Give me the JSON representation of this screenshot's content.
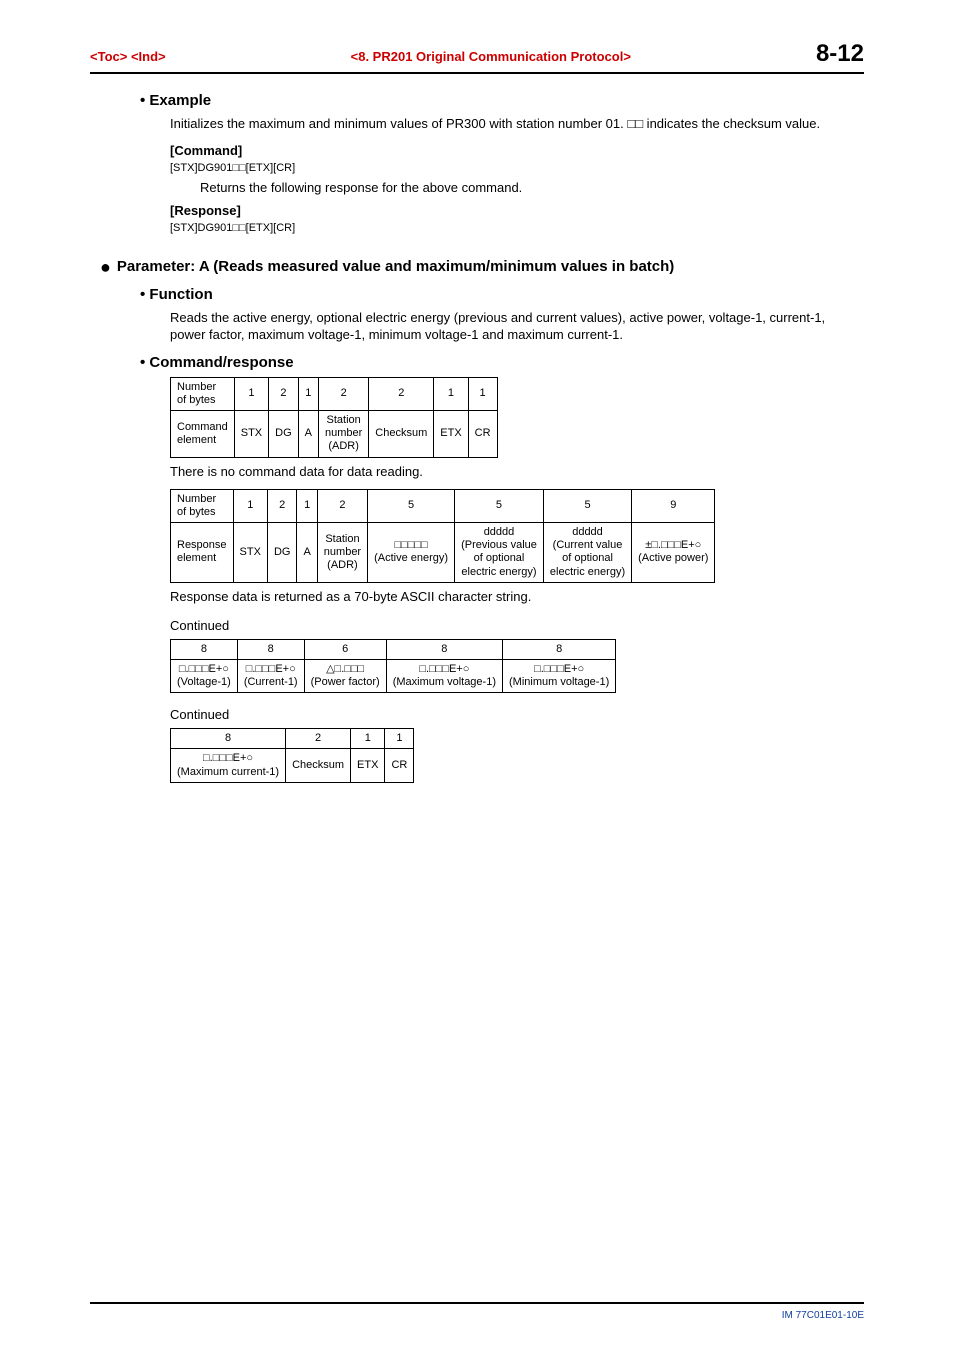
{
  "header": {
    "left": "<Toc> <Ind>",
    "center": "<8.  PR201 Original Communication Protocol>",
    "page": "8-12"
  },
  "example": {
    "title": "Example",
    "intro": "Initializes the maximum and minimum values of PR300 with station number 01. □□ indicates the checksum value.",
    "command_label": "[Command]",
    "command_code": "[STX]DG901□□[ETX][CR]",
    "response_note": "Returns the following response for the above command.",
    "response_label": "[Response]",
    "response_code": "[STX]DG901□□[ETX][CR]"
  },
  "paramA": {
    "title": "Parameter: A (Reads measured value and maximum/minimum values in batch)",
    "function_title": "Function",
    "function_text": "Reads the active energy, optional electric energy (previous and current values), active power, voltage-1, current-1, power factor, maximum voltage-1, minimum voltage-1 and maximum current-1.",
    "cr_title": "Command/response",
    "cmd_table": {
      "row1": [
        "Number\nof bytes",
        "1",
        "2",
        "1",
        "2",
        "2",
        "1",
        "1"
      ],
      "row2": [
        "Command\nelement",
        "STX",
        "DG",
        "A",
        "Station\nnumber\n(ADR)",
        "Checksum",
        "ETX",
        "CR"
      ]
    },
    "no_cmd_note": "There is no command data for data reading.",
    "resp_table": {
      "row1": [
        "Number\nof bytes",
        "1",
        "2",
        "1",
        "2",
        "5",
        "5",
        "5",
        "9"
      ],
      "row2": [
        "Response\nelement",
        "STX",
        "DG",
        "A",
        "Station\nnumber\n(ADR)",
        "□□□□□\n(Active energy)",
        "ddddd\n(Previous value\nof optional\nelectric energy)",
        "ddddd\n(Current value\nof optional\nelectric energy)",
        "±□.□□□E+○\n(Active power)"
      ]
    },
    "resp_note": "Response data is returned as a 70-byte ASCII character string.",
    "continued": "Continued",
    "cont1": {
      "row1": [
        "8",
        "8",
        "6",
        "8",
        "8"
      ],
      "row2": [
        "□.□□□E+○\n(Voltage-1)",
        "□.□□□E+○\n(Current-1)",
        "△□.□□□\n(Power factor)",
        "□.□□□E+○\n(Maximum voltage-1)",
        "□.□□□E+○\n(Minimum voltage-1)"
      ]
    },
    "cont2": {
      "row1": [
        "8",
        "2",
        "1",
        "1"
      ],
      "row2": [
        "□.□□□E+○\n(Maximum current-1)",
        "Checksum",
        "ETX",
        "CR"
      ]
    }
  },
  "footer": "IM 77C01E01-10E"
}
